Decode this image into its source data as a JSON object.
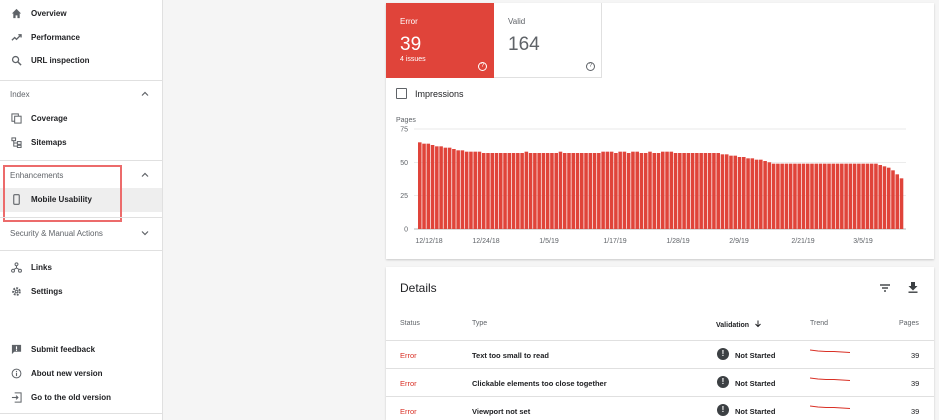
{
  "sidebar": {
    "overview": "Overview",
    "performance": "Performance",
    "url_inspection": "URL inspection",
    "index_section": "Index",
    "coverage": "Coverage",
    "sitemaps": "Sitemaps",
    "enhancements_section": "Enhancements",
    "mobile_usability": "Mobile Usability",
    "security_section": "Security & Manual Actions",
    "links": "Links",
    "settings": "Settings",
    "submit_feedback": "Submit feedback",
    "about_new_version": "About new version",
    "old_version": "Go to the old version"
  },
  "summary": {
    "error_label": "Error",
    "error_value": "39",
    "error_sub": "4 issues",
    "valid_label": "Valid",
    "valid_value": "164",
    "impressions_label": "Impressions"
  },
  "colors": {
    "error": "#e0443a",
    "status_text": "#d93025"
  },
  "chart_data": {
    "type": "bar",
    "ylabel": "Pages",
    "ylim": [
      0,
      75
    ],
    "yticks": [
      0,
      25,
      50,
      75
    ],
    "xticks": [
      "12/12/18",
      "12/24/18",
      "1/5/19",
      "1/17/19",
      "1/28/19",
      "2/9/19",
      "2/21/19",
      "3/5/19"
    ],
    "values": [
      65,
      64,
      64,
      63,
      62,
      62,
      61,
      61,
      60,
      59,
      59,
      58,
      58,
      58,
      58,
      57,
      57,
      57,
      57,
      57,
      57,
      57,
      57,
      57,
      57,
      58,
      57,
      57,
      57,
      57,
      57,
      57,
      57,
      58,
      57,
      57,
      57,
      57,
      57,
      57,
      57,
      57,
      57,
      58,
      58,
      58,
      57,
      58,
      58,
      57,
      58,
      58,
      57,
      57,
      58,
      57,
      57,
      58,
      58,
      58,
      57,
      57,
      57,
      57,
      57,
      57,
      57,
      57,
      57,
      57,
      57,
      56,
      56,
      55,
      55,
      54,
      54,
      53,
      53,
      52,
      52,
      51,
      50,
      49,
      49,
      49,
      49,
      49,
      49,
      49,
      49,
      49,
      49,
      49,
      49,
      49,
      49,
      49,
      49,
      49,
      49,
      49,
      49,
      49,
      49,
      49,
      49,
      49,
      48,
      47,
      46,
      44,
      41,
      38
    ]
  },
  "details": {
    "title": "Details",
    "headers": {
      "status": "Status",
      "type": "Type",
      "validation": "Validation",
      "trend": "Trend",
      "pages": "Pages"
    },
    "rows": [
      {
        "status": "Error",
        "type": "Text too small to read",
        "validation": "Not Started",
        "pages": "39"
      },
      {
        "status": "Error",
        "type": "Clickable elements too close together",
        "validation": "Not Started",
        "pages": "39"
      },
      {
        "status": "Error",
        "type": "Viewport not set",
        "validation": "Not Started",
        "pages": "39"
      }
    ]
  }
}
